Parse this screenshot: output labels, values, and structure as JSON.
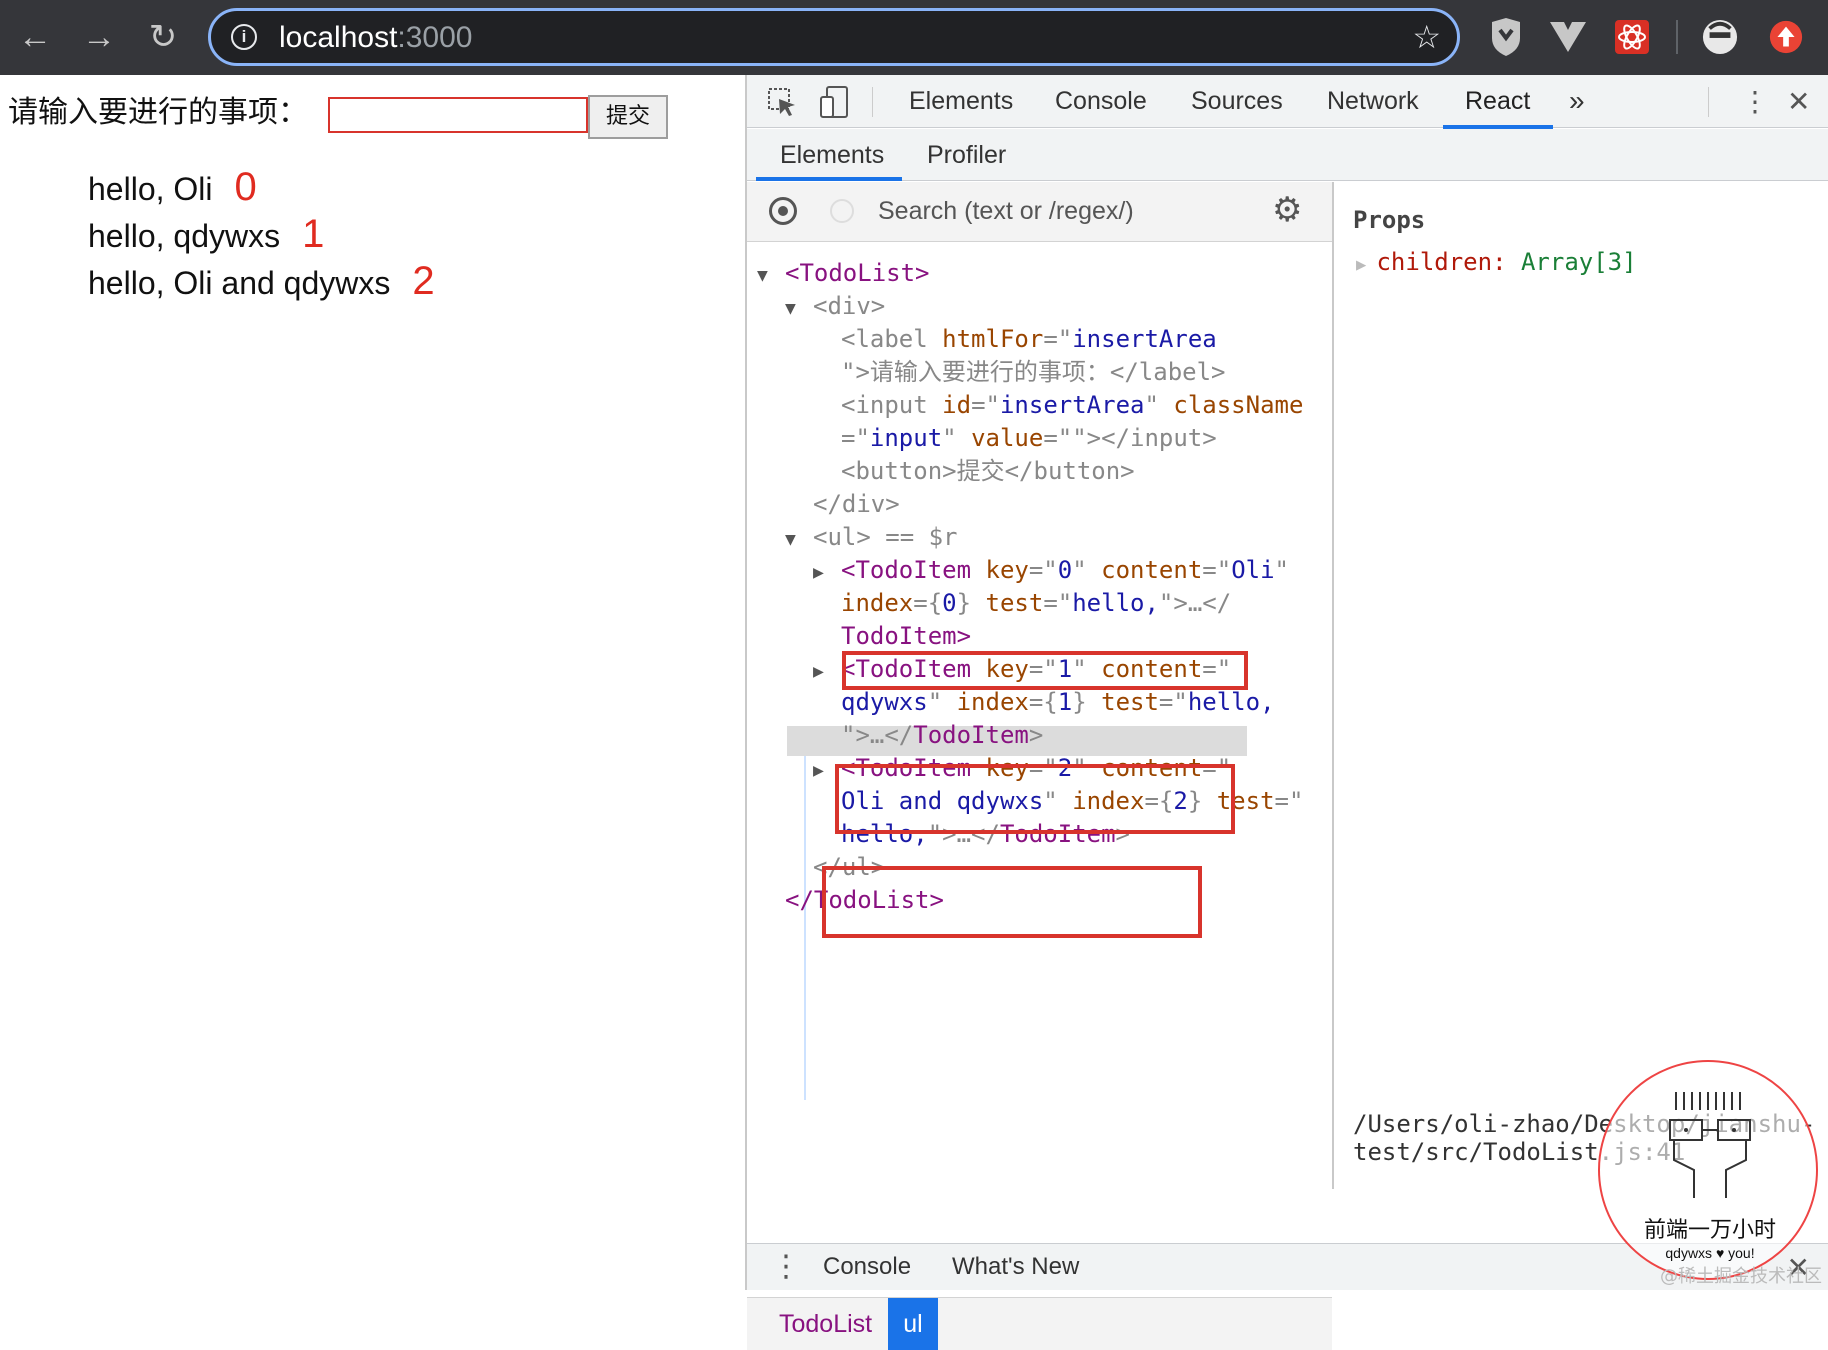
{
  "browser": {
    "url_host": "localhost",
    "url_port": ":3000"
  },
  "page": {
    "form_label": "请输入要进行的事项：",
    "input_value": "",
    "submit_label": "提交",
    "items": [
      {
        "text": "hello, Oli",
        "index": "0"
      },
      {
        "text": "hello, qdywxs",
        "index": "1"
      },
      {
        "text": "hello, Oli and qdywxs",
        "index": "2"
      }
    ]
  },
  "devtools": {
    "tabs": [
      "Elements",
      "Console",
      "Sources",
      "Network",
      "React"
    ],
    "more": "»",
    "subtabs": [
      "Elements",
      "Profiler"
    ],
    "search_placeholder": "Search (text or /regex/)",
    "breadcrumbs": [
      "TodoList",
      "ul"
    ],
    "props_title": "Props",
    "props_key": "children:",
    "props_value": "Array[3]",
    "source_path": "/Users/oli-zhao/Desktop/jianshu-\ntest/src/TodoList.js:41",
    "drawer_tabs": [
      "Console",
      "What's New"
    ]
  },
  "stamp": {
    "title": "前端一万小时",
    "subtitle": "qdywxs ♥ you!"
  },
  "watermark": "@稀土掘金技术社区",
  "colors": {
    "highlight_box": "#d8342c",
    "active_tab": "#1a73e8"
  }
}
